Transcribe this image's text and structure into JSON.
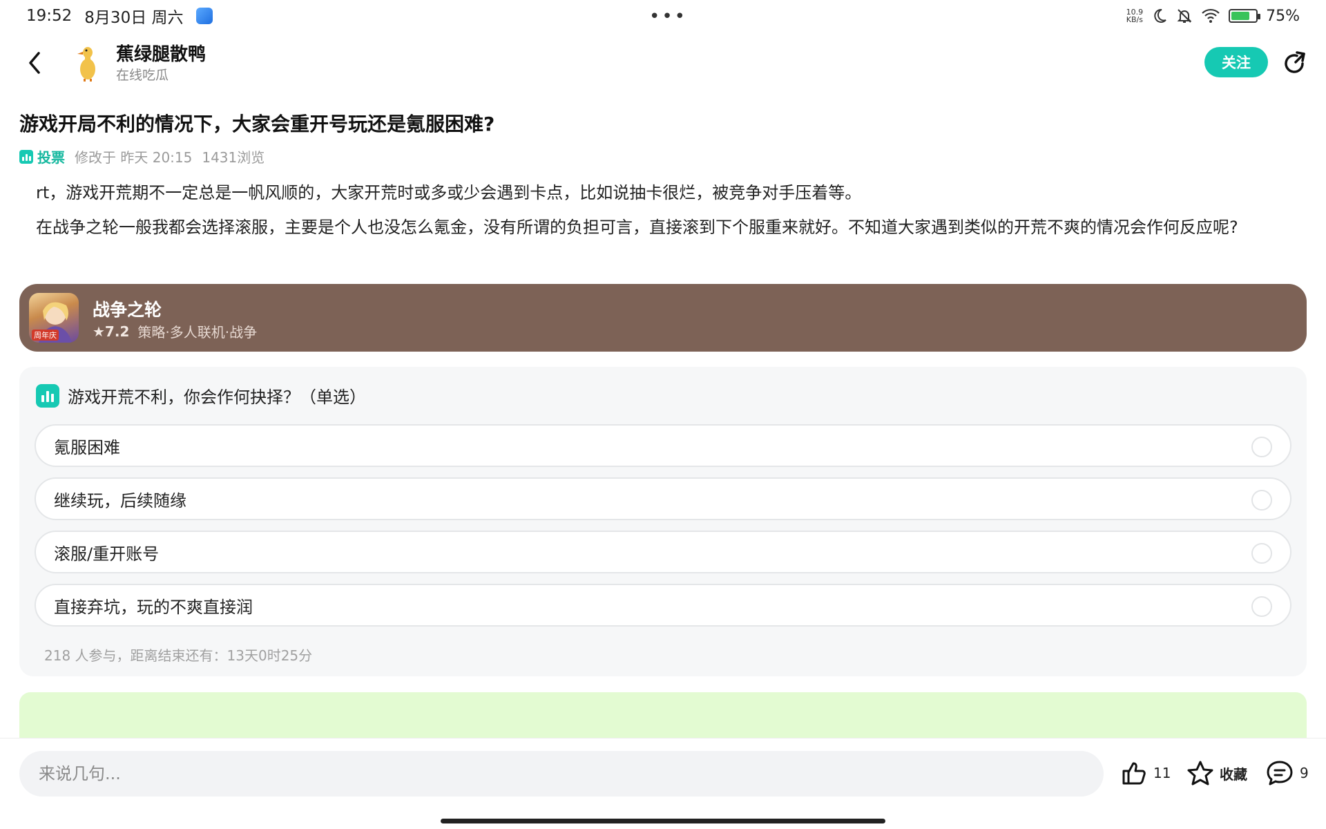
{
  "status_bar": {
    "time": "19:52",
    "date": "8月30日 周六",
    "net_speed_value": "10.9",
    "net_speed_unit": "KB/s",
    "battery_text": "75%",
    "battery_level": 0.75,
    "center_dots": "•••"
  },
  "header": {
    "author_name": "蕉绿腿散鸭",
    "author_subtitle": "在线吃瓜",
    "follow_label": "关注"
  },
  "post": {
    "title": "游戏开局不利的情况下，大家会重开号玩还是氪服困难?",
    "tag_label": "投票",
    "modified": "修改于 昨天 20:15",
    "views": "1431浏览",
    "paragraphs": [
      "rt，游戏开荒期不一定总是一帆风顺的，大家开荒时或多或少会遇到卡点，比如说抽卡很烂，被竞争对手压着等。",
      "在战争之轮一般我都会选择滚服，主要是个人也没怎么氪金，没有所谓的负担可言，直接滚到下个服重来就好。不知道大家遇到类似的开荒不爽的情况会作何反应呢?"
    ]
  },
  "game_card": {
    "name": "战争之轮",
    "score": "★7.2",
    "tags": "策略·多人联机·战争",
    "icon_badge": "周年庆"
  },
  "poll": {
    "question": "游戏开荒不利，你会作何抉择？（单选）",
    "options": [
      "氪服困难",
      "继续玩，后续随缘",
      "滚服/重开账号",
      "直接弃坑，玩的不爽直接润"
    ],
    "footer": "218 人参与，距离结束还有：13天0时25分"
  },
  "bottom_bar": {
    "comment_placeholder": "来说几句...",
    "like_count": "11",
    "favorite_label": "收藏",
    "comment_count": "9"
  },
  "colors": {
    "accent": "#16c9b3",
    "game_card_bg": "#7d6256",
    "poll_bg": "#f6f7f8",
    "banner_bg": "#e3fbd2"
  }
}
